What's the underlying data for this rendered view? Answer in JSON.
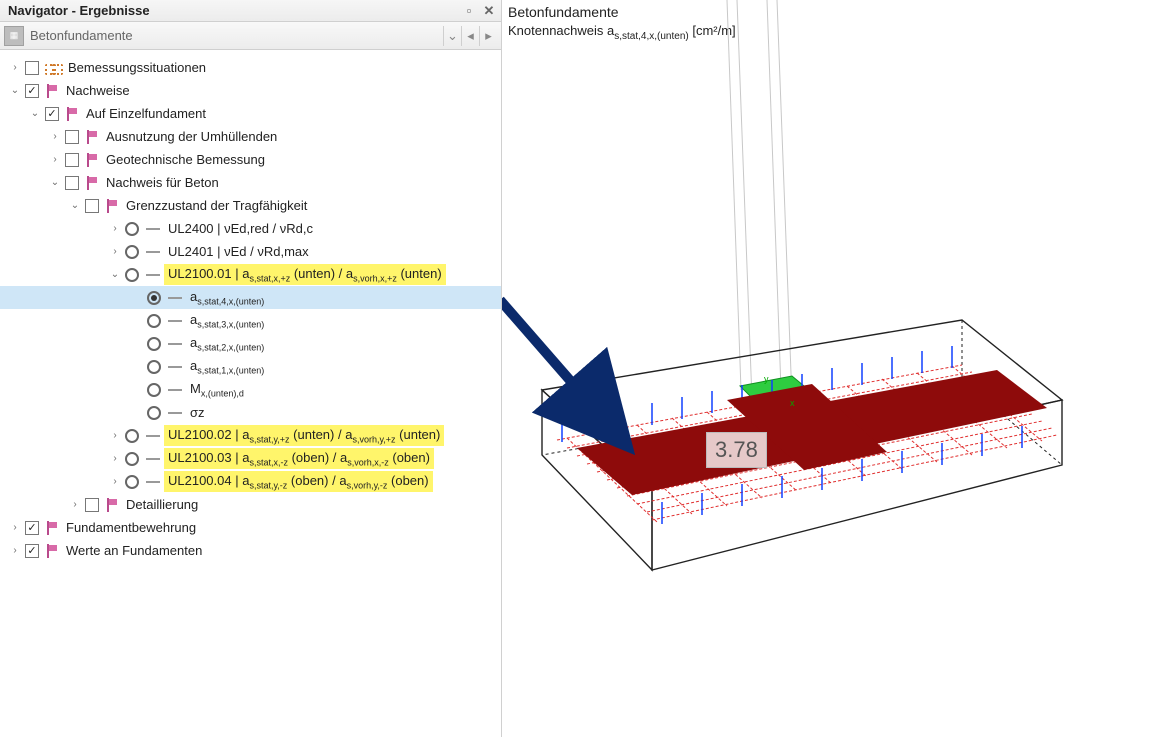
{
  "panel": {
    "title": "Navigator - Ergebnisse",
    "combo": "Betonfundamente"
  },
  "view": {
    "title": "Betonfundamente",
    "subtitle_prefix": "Knotennachweis a",
    "subtitle_sub": "s,stat,4,x,(unten)",
    "unit_html": " [cm²/m]",
    "value": "3.78",
    "axis_x": "x",
    "axis_y": "y"
  },
  "tree": {
    "bem": "Bemessungssituationen",
    "nachw": "Nachweise",
    "einz": "Auf Einzelfundament",
    "ausn": "Ausnutzung der Umhüllenden",
    "geot": "Geotechnische Bemessung",
    "nachb": "Nachweis für Beton",
    "grenz": "Grenzzustand der Tragfähigkeit",
    "ul2400": "UL2400 | νEd,red / νRd,c",
    "ul2401": "UL2401 | νEd / νRd,max",
    "ul2100_01_a": "UL2100.01 | a",
    "ul2100_01_b": " (unten) / a",
    "ul2100_01_c": " (unten)",
    "sub_stat_xz": "s,stat,x,+z",
    "sub_vorh_xz": "s,vorh,x,+z",
    "as4_a": "a",
    "as4_sub": "s,stat,4,x,(unten)",
    "as3_a": "a",
    "as3_sub": "s,stat,3,x,(unten)",
    "as2_a": "a",
    "as2_sub": "s,stat,2,x,(unten)",
    "as1_a": "a",
    "as1_sub": "s,stat,1,x,(unten)",
    "mx_a": "M",
    "mx_sub": "x,(unten),d",
    "sigz": "σz",
    "ul2100_02_a": "UL2100.02 | a",
    "sub_stat_yz": "s,stat,y,+z",
    "ul2100_02_b": " (unten) / a",
    "sub_vorh_yz": "s,vorh,y,+z",
    "ul2100_02_c": " (unten)",
    "ul2100_03_a": "UL2100.03 | a",
    "sub_stat_xmz": "s,stat,x,-z",
    "ul2100_03_b": " (oben) / a",
    "sub_vorh_xmz": "s,vorh,x,-z",
    "ul2100_03_c": " (oben)",
    "ul2100_04_a": "UL2100.04 | a",
    "sub_stat_ymz": "s,stat,y,-z",
    "ul2100_04_b": " (oben) / a",
    "sub_vorh_ymz": "s,vorh,y,-z",
    "ul2100_04_c": " (oben)",
    "det": "Detaillierung",
    "fund": "Fundamentbewehrung",
    "werte": "Werte an Fundamenten"
  }
}
